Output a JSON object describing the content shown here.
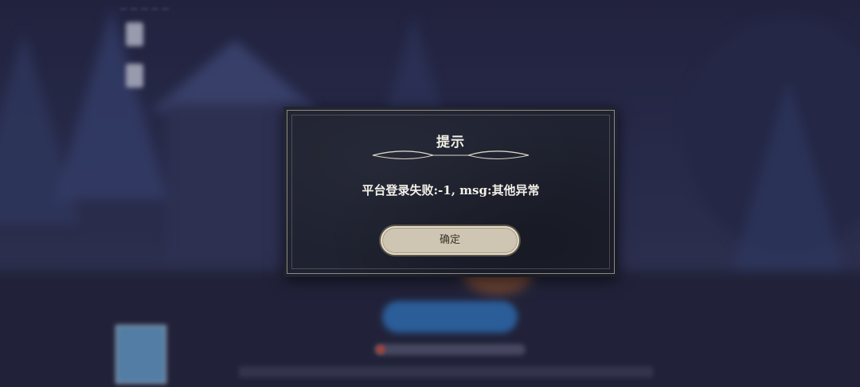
{
  "background": {
    "status_text": "— — — — —",
    "start_button_label": "",
    "agreement_text": ""
  },
  "dialog": {
    "title": "提示",
    "message": "平台登录失败:-1, msg:其他异常",
    "confirm_label": "确定"
  },
  "colors": {
    "dialog_bg": "#1f2230",
    "dialog_border": "#8d8a80",
    "text": "#f2efe6",
    "button_bg": "#cfc5b3",
    "button_text": "#3a3328",
    "bg_start_button": "#3a86d8"
  },
  "icons": [
    "title-ornament-icon",
    "age-rating-badge-icon",
    "agreement-check-icon"
  ]
}
